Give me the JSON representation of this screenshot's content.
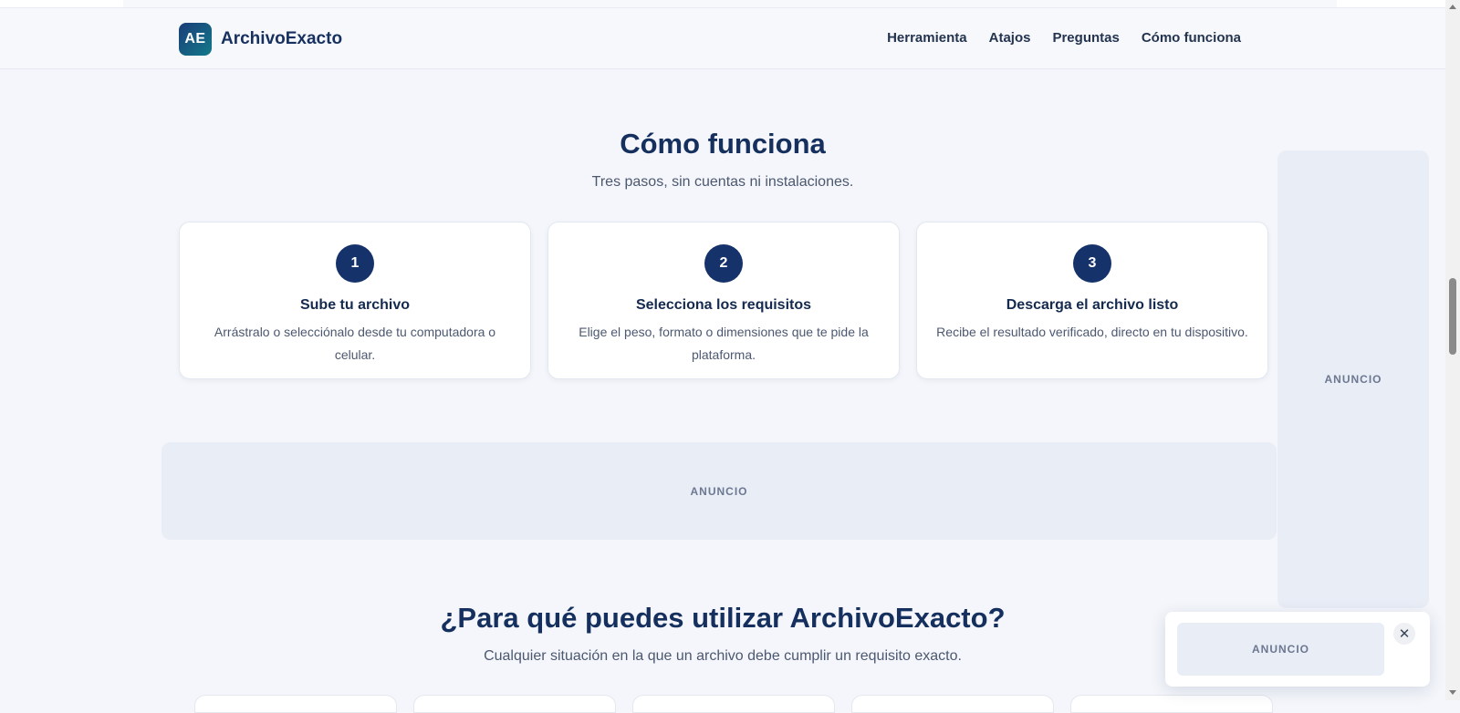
{
  "header": {
    "logo_text": "AE",
    "brand_name": "ArchivoExacto",
    "nav": [
      "Herramienta",
      "Atajos",
      "Preguntas",
      "Cómo funciona"
    ]
  },
  "how": {
    "title": "Cómo funciona",
    "subtitle": "Tres pasos, sin cuentas ni instalaciones.",
    "steps": [
      {
        "number": "1",
        "title": "Sube tu archivo",
        "desc": "Arrástralo o selecciónalo desde tu computadora o celular."
      },
      {
        "number": "2",
        "title": "Selecciona los requisitos",
        "desc": "Elige el peso, formato o dimensiones que te pide la plataforma."
      },
      {
        "number": "3",
        "title": "Descarga el archivo listo",
        "desc": "Recibe el resultado verificado, directo en tu dispositivo."
      }
    ]
  },
  "ads": {
    "banner_label": "ANUNCIO",
    "side_label": "ANUNCIO",
    "popup_label": "ANUNCIO",
    "close_symbol": "✕"
  },
  "uses": {
    "title": "¿Para qué puedes utilizar ArchivoExacto?",
    "subtitle": "Cualquier situación en la que un archivo debe cumplir un requisito exacto."
  },
  "colors": {
    "accent": "#15336a",
    "background": "#f4f6fb",
    "ad_fill": "#e9edf6"
  }
}
